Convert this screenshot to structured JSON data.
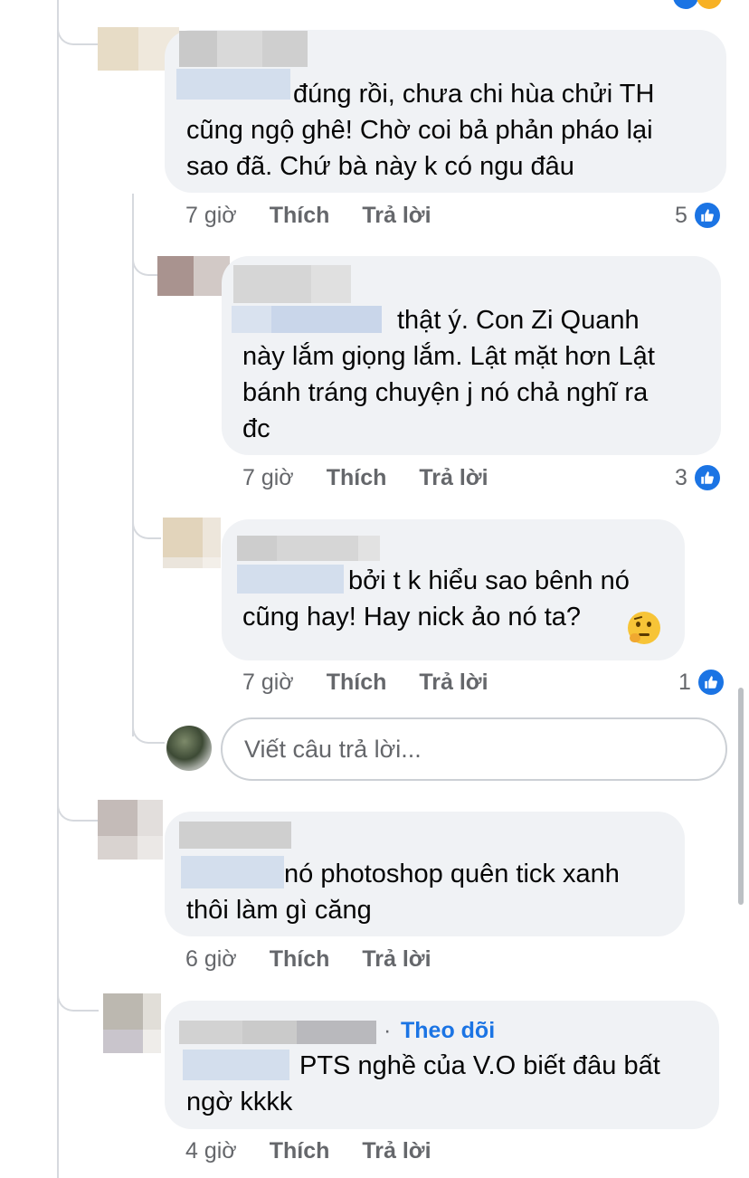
{
  "comments": [
    {
      "text": "đúng rồi, chưa chi hùa chửi TH\ncũng ngộ ghê! Chờ coi bả phản pháo lại\nsao đã. Chứ bà này k có ngu đâu",
      "time": "7 giờ",
      "like": "Thích",
      "reply": "Trả lời",
      "likes": "5"
    },
    {
      "text": "thật ý. Con Zi Quanh\nnày lắm giọng lắm. Lật mặt hơn Lật\nbánh tráng chuyện j nó chả nghĩ ra\nđc",
      "time": "7 giờ",
      "like": "Thích",
      "reply": "Trả lời",
      "likes": "3"
    },
    {
      "text": "bởi t k hiểu sao bênh nó\ncũng hay! Hay nick ảo nó ta?",
      "time": "7 giờ",
      "like": "Thích",
      "reply": "Trả lời",
      "likes": "1"
    },
    {
      "text": "nó photoshop quên tick xanh\nthôi làm gì căng",
      "time": "6 giờ",
      "like": "Thích",
      "reply": "Trả lời"
    },
    {
      "text": "PTS nghề của V.O biết đâu bất\nngờ kkkk",
      "follow": "Theo dõi",
      "time": "4 giờ",
      "like": "Thích",
      "reply": "Trả lời"
    }
  ],
  "reply_box": {
    "placeholder": "Viết câu trả lời..."
  },
  "icons": {
    "like": "thumbs-up-icon",
    "emoji": "thinking-face-emoji"
  },
  "colors": {
    "accent": "#1b74e4",
    "bubble": "#f0f2f5",
    "meta": "#65676b"
  }
}
